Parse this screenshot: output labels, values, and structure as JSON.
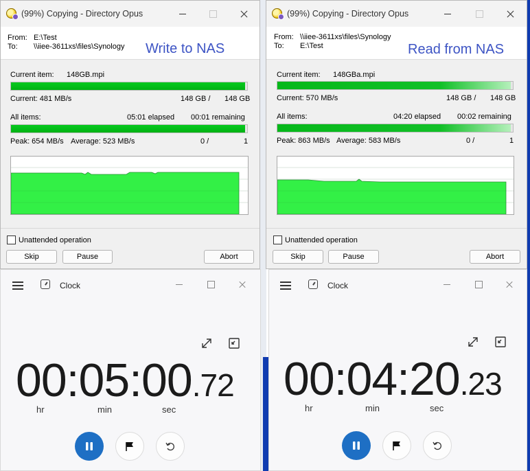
{
  "dialogs": [
    {
      "title": "(99%) Copying - Directory Opus",
      "from_label": "From:",
      "from_value": "E:\\Test",
      "to_label": "To:",
      "to_value": "\\\\iiee-3611xs\\files\\Synology",
      "annotation": "Write to NAS",
      "current_item_label": "Current item:",
      "current_item_value": "148GB.mpi",
      "current_progress": 0.99,
      "current_speed": "Current: 481 MB/s",
      "current_done": "148 GB /",
      "current_total": "148 GB",
      "all_items_label": "All items:",
      "elapsed": "05:01 elapsed",
      "remaining": "00:01 remaining",
      "all_progress": 0.99,
      "peak": "Peak: 654 MB/s",
      "average": "Average: 523 MB/s",
      "items_done": "0 /",
      "items_total": "1",
      "graph_level": 0.74,
      "unattended_label": "Unattended operation",
      "skip_label": "Skip",
      "pause_label": "Pause",
      "abort_label": "Abort"
    },
    {
      "title": "(99%) Copying - Directory Opus",
      "from_label": "From:",
      "from_value": "\\\\iiee-3611xs\\files\\Synology",
      "to_label": "To:",
      "to_value": "E:\\Test",
      "annotation": "Read from NAS",
      "current_item_label": "Current item:",
      "current_item_value": "148GBa.mpi",
      "current_progress": 0.99,
      "current_speed": "Current: 570 MB/s",
      "current_done": "148 GB /",
      "current_total": "148 GB",
      "all_items_label": "All items:",
      "elapsed": "04:20 elapsed",
      "remaining": "00:02 remaining",
      "all_progress": 0.99,
      "peak": "Peak: 863 MB/s",
      "average": "Average: 583 MB/s",
      "items_done": "0 /",
      "items_total": "1",
      "graph_level": 0.6,
      "unattended_label": "Unattended operation",
      "skip_label": "Skip",
      "pause_label": "Pause",
      "abort_label": "Abort"
    }
  ],
  "clocks": [
    {
      "title": "Clock",
      "time_main": "00:05:00",
      "time_cs": ".72",
      "hr_label": "hr",
      "min_label": "min",
      "sec_label": "sec"
    },
    {
      "title": "Clock",
      "time_main": "00:04:20",
      "time_cs": ".23",
      "hr_label": "hr",
      "min_label": "min",
      "sec_label": "sec"
    }
  ],
  "colors": {
    "progress_green": "#02b818",
    "graph_green": "#33f046",
    "annotation_blue": "#3d54c4",
    "play_blue": "#1e6fc4",
    "desktop_blue": "#0f3bb0"
  }
}
